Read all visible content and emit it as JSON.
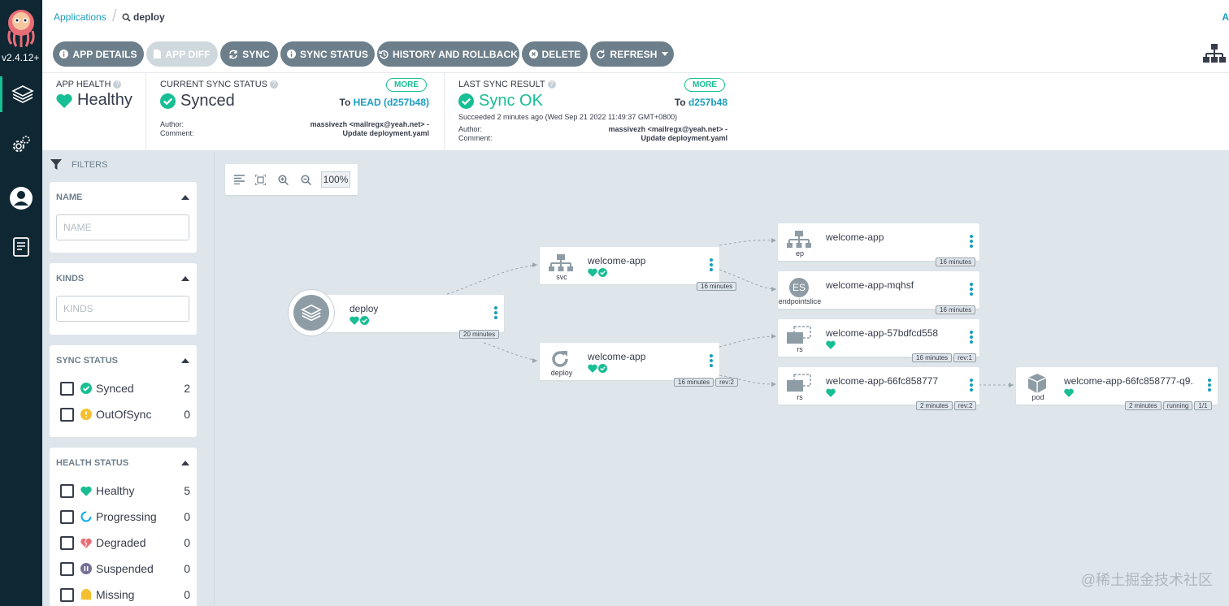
{
  "nav": {
    "version": "v2.4.12+",
    "items": [
      "applications-icon",
      "settings-icon",
      "user-icon",
      "docs-icon"
    ]
  },
  "breadcrumb": {
    "applications": "Applications",
    "current": "deploy",
    "right_label": "A"
  },
  "toolbar": {
    "app_details": "APP DETAILS",
    "app_diff": "APP DIFF",
    "sync": "SYNC",
    "sync_status": "SYNC STATUS",
    "history": "HISTORY AND ROLLBACK",
    "delete": "DELETE",
    "refresh": "REFRESH"
  },
  "status": {
    "app_health": {
      "label": "APP HEALTH",
      "value": "Healthy"
    },
    "current_sync": {
      "label": "CURRENT SYNC STATUS",
      "value": "Synced",
      "more": "MORE",
      "to_prefix": "To",
      "to_value": "HEAD (d257b48)",
      "author_label": "Author:",
      "comment_label": "Comment:",
      "author": "massivezh <mailregx@yeah.net> -",
      "comment": "Update deployment.yaml"
    },
    "last_sync": {
      "label": "LAST SYNC RESULT",
      "value": "Sync OK",
      "more": "MORE",
      "to_prefix": "To",
      "to_value": "d257b48",
      "succeeded": "Succeeded 2 minutes ago (Wed Sep 21 2022 11:49:37 GMT+0800)",
      "author_label": "Author:",
      "comment_label": "Comment:",
      "author": "massivezh <mailregx@yeah.net> -",
      "comment": "Update deployment.yaml"
    }
  },
  "filters": {
    "title": "FILTERS",
    "name": {
      "header": "NAME",
      "placeholder": "NAME"
    },
    "kinds": {
      "header": "KINDS",
      "placeholder": "KINDS"
    },
    "sync_status": {
      "header": "SYNC STATUS",
      "items": [
        {
          "label": "Synced",
          "count": "2"
        },
        {
          "label": "OutOfSync",
          "count": "0"
        }
      ]
    },
    "health_status": {
      "header": "HEALTH STATUS",
      "items": [
        {
          "label": "Healthy",
          "count": "5"
        },
        {
          "label": "Progressing",
          "count": "0"
        },
        {
          "label": "Degraded",
          "count": "0"
        },
        {
          "label": "Suspended",
          "count": "0"
        },
        {
          "label": "Missing",
          "count": "0"
        }
      ]
    }
  },
  "graph": {
    "zoom": "100%",
    "colors": {
      "healthy": "#18be94",
      "progressing": "#0dadea",
      "degraded": "#e96d76",
      "suspended": "#766f94",
      "missing": "#f4c030",
      "outofsync": "#f4c030"
    },
    "nodes": {
      "app": {
        "name": "deploy",
        "tags": [
          "20 minutes"
        ]
      },
      "svc": {
        "name": "welcome-app",
        "kind": "svc",
        "tags": [
          "16 minutes"
        ]
      },
      "deploy": {
        "name": "welcome-app",
        "kind": "deploy",
        "tags": [
          "16 minutes",
          "rev:2"
        ]
      },
      "ep": {
        "name": "welcome-app",
        "kind": "ep",
        "tags": [
          "16 minutes"
        ]
      },
      "es": {
        "name": "welcome-app-mqhsf",
        "kind": "endpointslice",
        "badge": "ES",
        "tags": [
          "16 minutes"
        ]
      },
      "rs1": {
        "name": "welcome-app-57bdfcd558",
        "kind": "rs",
        "tags": [
          "16 minutes",
          "rev:1"
        ]
      },
      "rs2": {
        "name": "welcome-app-66fc858777",
        "kind": "rs",
        "tags": [
          "2 minutes",
          "rev:2"
        ]
      },
      "pod": {
        "name": "welcome-app-66fc858777-q9...",
        "kind": "pod",
        "tags": [
          "2 minutes",
          "running",
          "1/1"
        ]
      }
    }
  },
  "watermark": "@稀土掘金技术社区"
}
